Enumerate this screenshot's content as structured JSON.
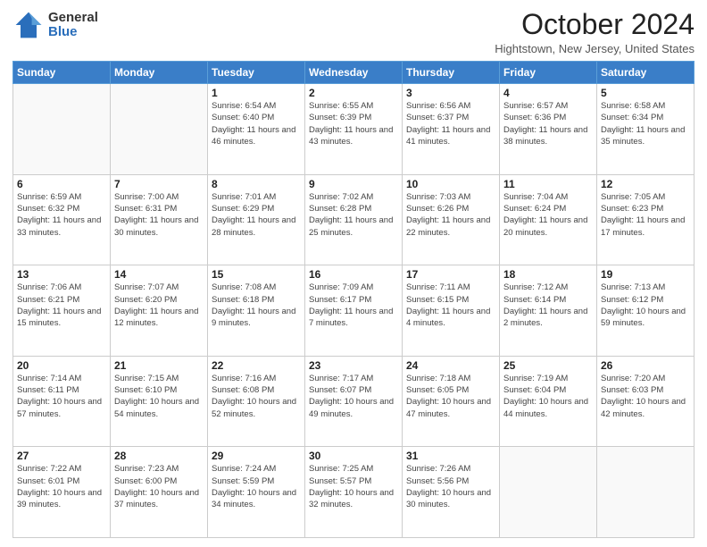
{
  "logo": {
    "general": "General",
    "blue": "Blue"
  },
  "header": {
    "title": "October 2024",
    "subtitle": "Hightstown, New Jersey, United States"
  },
  "days_of_week": [
    "Sunday",
    "Monday",
    "Tuesday",
    "Wednesday",
    "Thursday",
    "Friday",
    "Saturday"
  ],
  "weeks": [
    [
      {
        "day": "",
        "info": ""
      },
      {
        "day": "",
        "info": ""
      },
      {
        "day": "1",
        "info": "Sunrise: 6:54 AM\nSunset: 6:40 PM\nDaylight: 11 hours and 46 minutes."
      },
      {
        "day": "2",
        "info": "Sunrise: 6:55 AM\nSunset: 6:39 PM\nDaylight: 11 hours and 43 minutes."
      },
      {
        "day": "3",
        "info": "Sunrise: 6:56 AM\nSunset: 6:37 PM\nDaylight: 11 hours and 41 minutes."
      },
      {
        "day": "4",
        "info": "Sunrise: 6:57 AM\nSunset: 6:36 PM\nDaylight: 11 hours and 38 minutes."
      },
      {
        "day": "5",
        "info": "Sunrise: 6:58 AM\nSunset: 6:34 PM\nDaylight: 11 hours and 35 minutes."
      }
    ],
    [
      {
        "day": "6",
        "info": "Sunrise: 6:59 AM\nSunset: 6:32 PM\nDaylight: 11 hours and 33 minutes."
      },
      {
        "day": "7",
        "info": "Sunrise: 7:00 AM\nSunset: 6:31 PM\nDaylight: 11 hours and 30 minutes."
      },
      {
        "day": "8",
        "info": "Sunrise: 7:01 AM\nSunset: 6:29 PM\nDaylight: 11 hours and 28 minutes."
      },
      {
        "day": "9",
        "info": "Sunrise: 7:02 AM\nSunset: 6:28 PM\nDaylight: 11 hours and 25 minutes."
      },
      {
        "day": "10",
        "info": "Sunrise: 7:03 AM\nSunset: 6:26 PM\nDaylight: 11 hours and 22 minutes."
      },
      {
        "day": "11",
        "info": "Sunrise: 7:04 AM\nSunset: 6:24 PM\nDaylight: 11 hours and 20 minutes."
      },
      {
        "day": "12",
        "info": "Sunrise: 7:05 AM\nSunset: 6:23 PM\nDaylight: 11 hours and 17 minutes."
      }
    ],
    [
      {
        "day": "13",
        "info": "Sunrise: 7:06 AM\nSunset: 6:21 PM\nDaylight: 11 hours and 15 minutes."
      },
      {
        "day": "14",
        "info": "Sunrise: 7:07 AM\nSunset: 6:20 PM\nDaylight: 11 hours and 12 minutes."
      },
      {
        "day": "15",
        "info": "Sunrise: 7:08 AM\nSunset: 6:18 PM\nDaylight: 11 hours and 9 minutes."
      },
      {
        "day": "16",
        "info": "Sunrise: 7:09 AM\nSunset: 6:17 PM\nDaylight: 11 hours and 7 minutes."
      },
      {
        "day": "17",
        "info": "Sunrise: 7:11 AM\nSunset: 6:15 PM\nDaylight: 11 hours and 4 minutes."
      },
      {
        "day": "18",
        "info": "Sunrise: 7:12 AM\nSunset: 6:14 PM\nDaylight: 11 hours and 2 minutes."
      },
      {
        "day": "19",
        "info": "Sunrise: 7:13 AM\nSunset: 6:12 PM\nDaylight: 10 hours and 59 minutes."
      }
    ],
    [
      {
        "day": "20",
        "info": "Sunrise: 7:14 AM\nSunset: 6:11 PM\nDaylight: 10 hours and 57 minutes."
      },
      {
        "day": "21",
        "info": "Sunrise: 7:15 AM\nSunset: 6:10 PM\nDaylight: 10 hours and 54 minutes."
      },
      {
        "day": "22",
        "info": "Sunrise: 7:16 AM\nSunset: 6:08 PM\nDaylight: 10 hours and 52 minutes."
      },
      {
        "day": "23",
        "info": "Sunrise: 7:17 AM\nSunset: 6:07 PM\nDaylight: 10 hours and 49 minutes."
      },
      {
        "day": "24",
        "info": "Sunrise: 7:18 AM\nSunset: 6:05 PM\nDaylight: 10 hours and 47 minutes."
      },
      {
        "day": "25",
        "info": "Sunrise: 7:19 AM\nSunset: 6:04 PM\nDaylight: 10 hours and 44 minutes."
      },
      {
        "day": "26",
        "info": "Sunrise: 7:20 AM\nSunset: 6:03 PM\nDaylight: 10 hours and 42 minutes."
      }
    ],
    [
      {
        "day": "27",
        "info": "Sunrise: 7:22 AM\nSunset: 6:01 PM\nDaylight: 10 hours and 39 minutes."
      },
      {
        "day": "28",
        "info": "Sunrise: 7:23 AM\nSunset: 6:00 PM\nDaylight: 10 hours and 37 minutes."
      },
      {
        "day": "29",
        "info": "Sunrise: 7:24 AM\nSunset: 5:59 PM\nDaylight: 10 hours and 34 minutes."
      },
      {
        "day": "30",
        "info": "Sunrise: 7:25 AM\nSunset: 5:57 PM\nDaylight: 10 hours and 32 minutes."
      },
      {
        "day": "31",
        "info": "Sunrise: 7:26 AM\nSunset: 5:56 PM\nDaylight: 10 hours and 30 minutes."
      },
      {
        "day": "",
        "info": ""
      },
      {
        "day": "",
        "info": ""
      }
    ]
  ]
}
